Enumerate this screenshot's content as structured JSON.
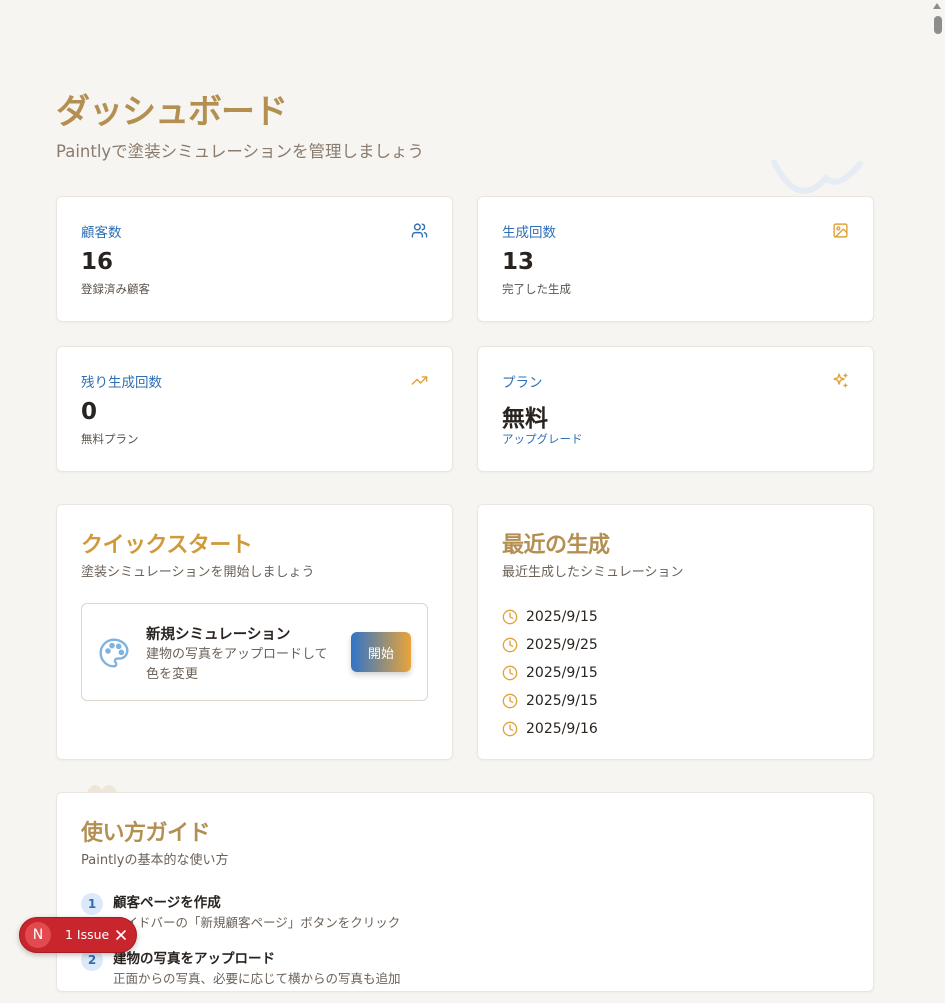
{
  "header": {
    "title": "ダッシュボード",
    "subtitle": "Paintlyで塗装シミュレーションを管理しましょう"
  },
  "stats": [
    {
      "label": "顧客数",
      "value": "16",
      "note": "登録済み顧客",
      "icon": "users-icon"
    },
    {
      "label": "生成回数",
      "value": "13",
      "note": "完了した生成",
      "icon": "image-icon"
    },
    {
      "label": "残り生成回数",
      "value": "0",
      "note": "無料プラン",
      "icon": "trending-up-icon"
    },
    {
      "label": "プラン",
      "value": "無料",
      "note": "アップグレード",
      "icon": "sparkles-icon"
    }
  ],
  "quick_start": {
    "title": "クイックスタート",
    "subtitle": "塗装シミュレーションを開始しましょう",
    "item_title": "新規シミュレーション",
    "item_desc": "建物の写真をアップロードして色を変更",
    "button_label": "開始"
  },
  "recent": {
    "title": "最近の生成",
    "subtitle": "最近生成したシミュレーション",
    "items": [
      "2025/9/15",
      "2025/9/25",
      "2025/9/15",
      "2025/9/15",
      "2025/9/16"
    ]
  },
  "guide": {
    "title": "使い方ガイド",
    "subtitle": "Paintlyの基本的な使い方",
    "steps": [
      {
        "num": "1",
        "title": "顧客ページを作成",
        "desc": "サイドバーの「新規顧客ページ」ボタンをクリック"
      },
      {
        "num": "2",
        "title": "建物の写真をアップロード",
        "desc": "正面からの写真、必要に応じて横からの写真も追加"
      }
    ]
  },
  "issue_badge": {
    "avatar": "N",
    "label": "1 Issue"
  },
  "colors": {
    "accent_blue": "#2f6fb7",
    "accent_gold": "#cf9b3a",
    "title_gold": "#b48f52",
    "issue_red": "#c8252c"
  }
}
